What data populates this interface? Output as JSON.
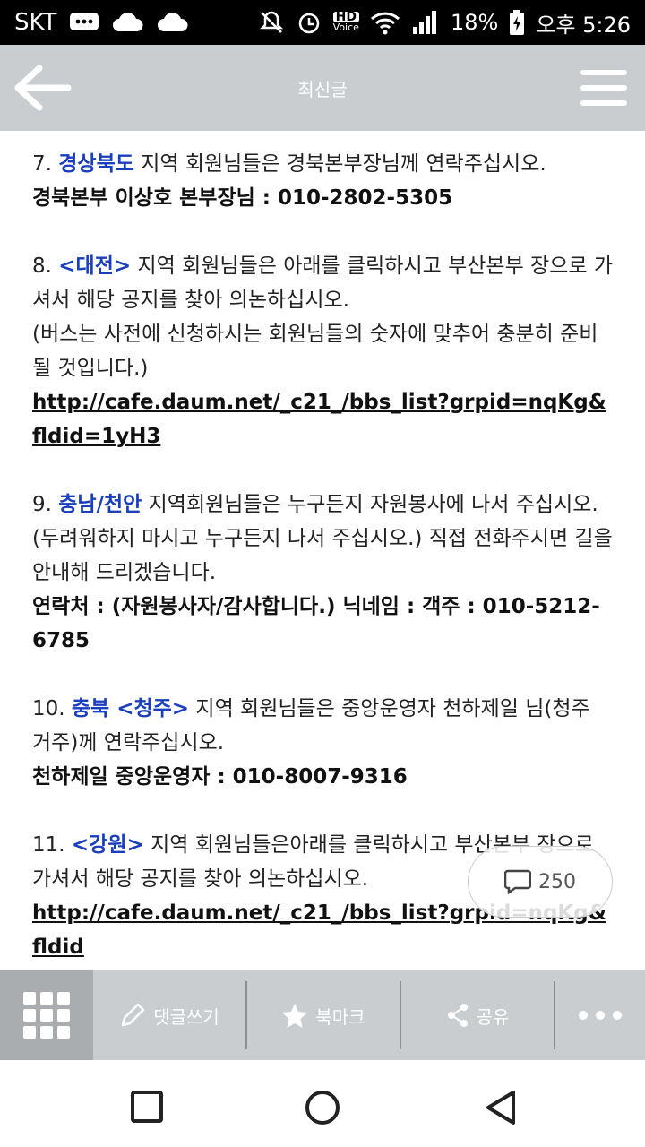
{
  "status_bar": {
    "carrier": "SKT",
    "battery": "18%",
    "time": "오후 5:26",
    "hd_badge_top": "HD",
    "hd_badge_bottom": "Voice",
    "icons": [
      "message-icon",
      "cloud-icon",
      "cloud-icon",
      "mute-icon",
      "alarm-icon",
      "hd-voice-icon",
      "wifi-icon",
      "signal-icon",
      "battery-charging-icon"
    ]
  },
  "app_bar": {
    "title": "최신글"
  },
  "post": {
    "s7": {
      "num": "7. ",
      "region": "경상북도",
      "text": " 지역 회원님들은 경북본부장님께 연락주십시오.",
      "contact": "경북본부 이상호 본부장님 :  010-2802-5305"
    },
    "s8": {
      "num": "8. ",
      "region": "<대전>",
      "text": " 지역 회원님들은 아래를 클릭하시고 부산본부 장으로 가셔서 해당 공지를 찾아 의논하십시오.",
      "note": "(버스는 사전에 신청하시는 회원님들의 숫자에 맞추어 충분히 준비될 것입니다.)",
      "link": "http://cafe.daum.net/_c21_/bbs_list?grpid=nqKg&fldid=1yH3"
    },
    "s9": {
      "num": "9. ",
      "region": "충남/천안",
      "text": " 지역회원님들은 누구든지 자원봉사에 나서 주십시오.",
      "note": "(두려워하지 마시고 누구든지 나서 주십시오.) 직접 전화주시면 길을 안내해 드리겠습니다.",
      "contact": "연락처 : (자원봉사자/감사합니다.) 닉네임 : 객주 : 010-5212-6785"
    },
    "s10": {
      "num": "10. ",
      "region": "충북 <청주>",
      "text": " 지역 회원님들은 중앙운영자 천하제일 님(청주 거주)께 연락주십시오.",
      "contact": "천하제일 중앙운영자 : 010-8007-9316"
    },
    "s11": {
      "num": "11. ",
      "region": "<강원>",
      "text": " 지역 회원님들은아래를 클릭하시고 부산본부 장으로 가셔서 해당 공지를 찾아 의논하십시오.",
      "link": "http://cafe.daum.net/_c21_/bbs_list?grpid=nqKg&fldid"
    }
  },
  "comment_count": "250",
  "bottom_bar": {
    "write_comment": "댓글쓰기",
    "bookmark": "북마크",
    "share": "공유"
  },
  "colors": {
    "region": "#1a3fbd",
    "appbar": "#c9cdd0"
  }
}
